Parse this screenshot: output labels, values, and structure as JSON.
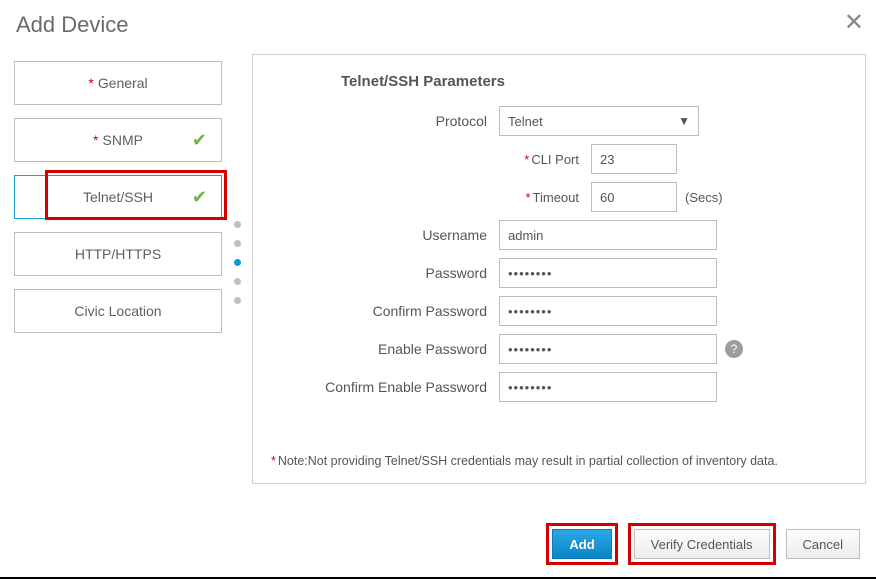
{
  "dialog": {
    "title": "Add Device"
  },
  "sidebar": {
    "steps": [
      {
        "label": "General",
        "required": true,
        "checked": false
      },
      {
        "label": "SNMP",
        "required": true,
        "checked": true
      },
      {
        "label": "Telnet/SSH",
        "required": false,
        "checked": true
      },
      {
        "label": "HTTP/HTTPS",
        "required": false,
        "checked": false
      },
      {
        "label": "Civic Location",
        "required": false,
        "checked": false
      }
    ]
  },
  "panel": {
    "title": "Telnet/SSH Parameters",
    "labels": {
      "protocol": "Protocol",
      "cli_port": "CLI Port",
      "timeout": "Timeout",
      "timeout_suffix": "(Secs)",
      "username": "Username",
      "password": "Password",
      "confirm_password": "Confirm Password",
      "enable_password": "Enable Password",
      "confirm_enable_password": "Confirm Enable Password"
    },
    "values": {
      "protocol": "Telnet",
      "cli_port": "23",
      "timeout": "60",
      "username": "admin",
      "password_mask": "••••••••",
      "confirm_password_mask": "••••••••",
      "enable_password_mask": "••••••••",
      "confirm_enable_password_mask": "••••••••"
    },
    "note": "Note:Not providing Telnet/SSH credentials may result in partial collection of inventory data."
  },
  "footer": {
    "add": "Add",
    "verify": "Verify Credentials",
    "cancel": "Cancel"
  }
}
